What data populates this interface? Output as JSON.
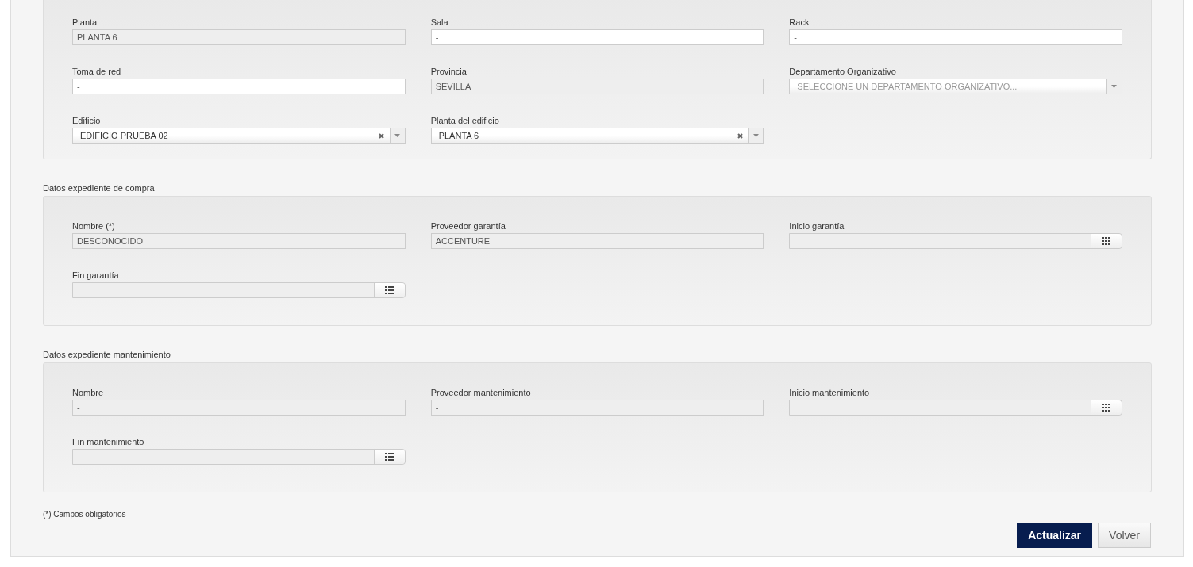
{
  "sections": [
    {
      "fields": [
        {
          "label": "Planta",
          "kind": "text",
          "value": "PLANTA 6",
          "readonly": true
        },
        {
          "label": "Sala",
          "kind": "text",
          "value": "-",
          "readonly": false
        },
        {
          "label": "Rack",
          "kind": "text",
          "value": "-",
          "readonly": false
        },
        {
          "label": "Toma de red",
          "kind": "text",
          "value": "-",
          "readonly": false
        },
        {
          "label": "Provincia",
          "kind": "text",
          "value": "SEVILLA",
          "readonly": true
        },
        {
          "label": "Departamento Organizativo",
          "kind": "select",
          "placeholder": "SELECCIONE UN DEPARTAMENTO ORGANIZATIVO...",
          "clearable": false
        },
        {
          "label": "Edificio",
          "kind": "select",
          "value": "EDIFICIO PRUEBA 02",
          "clearable": true
        },
        {
          "label": "Planta del edificio",
          "kind": "select",
          "value": "PLANTA 6",
          "clearable": true
        }
      ]
    },
    {
      "title": "Datos expediente de compra",
      "fields": [
        {
          "label": "Nombre (*)",
          "kind": "text",
          "value": "DESCONOCIDO",
          "readonly": true
        },
        {
          "label": "Proveedor garantía",
          "kind": "text",
          "value": "ACCENTURE",
          "readonly": true
        },
        {
          "label": "Inicio garantía",
          "kind": "date",
          "readonly": true
        },
        {
          "label": "Fin garantía",
          "kind": "date",
          "readonly": true
        }
      ]
    },
    {
      "title": "Datos expediente mantenimiento",
      "fields": [
        {
          "label": "Nombre",
          "kind": "text",
          "value": "-",
          "readonly": true
        },
        {
          "label": "Proveedor mantenimiento",
          "kind": "text",
          "value": "-",
          "readonly": true
        },
        {
          "label": "Inicio mantenimiento",
          "kind": "date",
          "readonly": true
        },
        {
          "label": "Fin mantenimiento",
          "kind": "date",
          "readonly": true
        }
      ]
    }
  ],
  "footnote": "(*) Campos obligatorios",
  "buttons": [
    {
      "label": "Actualizar",
      "kind": "primary"
    },
    {
      "label": "Volver",
      "kind": "secondary"
    }
  ]
}
